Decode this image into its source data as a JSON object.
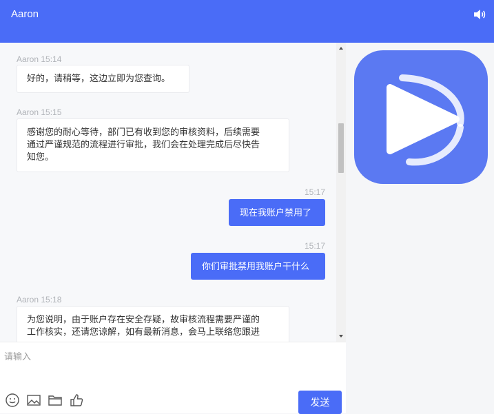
{
  "header": {
    "title": "Aaron",
    "speaker_icon": "speaker-icon"
  },
  "messages": [
    {
      "from": "agent",
      "meta": "Aaron 15:14",
      "lines": [
        "好的，请稍等，这边立即为您查询。"
      ]
    },
    {
      "from": "agent",
      "meta": "Aaron 15:15",
      "lines": [
        "感谢您的耐心等待，部门已有收到您的审核资料，后续需要",
        "通过严谨规范的流程进行审批，我们会在处理完成后尽快告",
        "知您。"
      ]
    },
    {
      "from": "user",
      "meta": "15:17",
      "lines": [
        "现在我账户禁用了"
      ]
    },
    {
      "from": "user",
      "meta": "15:17",
      "lines": [
        "你们审批禁用我账户干什么"
      ]
    },
    {
      "from": "agent",
      "meta": "Aaron 15:18",
      "lines": [
        "为您说明，由于账户存在安全存疑，故审核流程需要严谨的",
        "工作核实，还请您谅解，如有最新消息，会马上联络您跟进"
      ]
    }
  ],
  "composer": {
    "placeholder": "请输入",
    "send_label": "发送",
    "tools": [
      "emoji-icon",
      "image-icon",
      "folder-icon",
      "thumbs-up-icon"
    ]
  },
  "colors": {
    "brand": "#4a6cf7",
    "chat_bg": "#f7f8fa",
    "side_bg": "#f5f6f8"
  }
}
